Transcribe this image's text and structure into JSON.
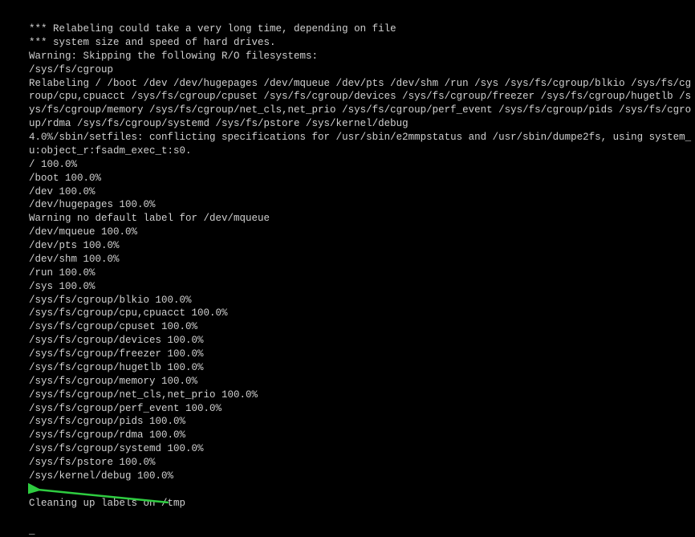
{
  "terminal": {
    "lines": [
      "*** Relabeling could take a very long time, depending on file",
      "*** system size and speed of hard drives.",
      "Warning: Skipping the following R/O filesystems:",
      "/sys/fs/cgroup",
      "Relabeling / /boot /dev /dev/hugepages /dev/mqueue /dev/pts /dev/shm /run /sys /sys/fs/cgroup/blkio /sys/fs/cgroup/cpu,cpuacct /sys/fs/cgroup/cpuset /sys/fs/cgroup/devices /sys/fs/cgroup/freezer /sys/fs/cgroup/hugetlb /sys/fs/cgroup/memory /sys/fs/cgroup/net_cls,net_prio /sys/fs/cgroup/perf_event /sys/fs/cgroup/pids /sys/fs/cgroup/rdma /sys/fs/cgroup/systemd /sys/fs/pstore /sys/kernel/debug",
      "4.0%/sbin/setfiles: conflicting specifications for /usr/sbin/e2mmpstatus and /usr/sbin/dumpe2fs, using system_u:object_r:fsadm_exec_t:s0.",
      "/ 100.0%",
      "/boot 100.0%",
      "/dev 100.0%",
      "/dev/hugepages 100.0%",
      "Warning no default label for /dev/mqueue",
      "/dev/mqueue 100.0%",
      "/dev/pts 100.0%",
      "/dev/shm 100.0%",
      "/run 100.0%",
      "/sys 100.0%",
      "/sys/fs/cgroup/blkio 100.0%",
      "/sys/fs/cgroup/cpu,cpuacct 100.0%",
      "/sys/fs/cgroup/cpuset 100.0%",
      "/sys/fs/cgroup/devices 100.0%",
      "/sys/fs/cgroup/freezer 100.0%",
      "/sys/fs/cgroup/hugetlb 100.0%",
      "/sys/fs/cgroup/memory 100.0%",
      "/sys/fs/cgroup/net_cls,net_prio 100.0%",
      "/sys/fs/cgroup/perf_event 100.0%",
      "/sys/fs/cgroup/pids 100.0%",
      "/sys/fs/cgroup/rdma 100.0%",
      "/sys/fs/cgroup/systemd 100.0%",
      "/sys/fs/pstore 100.0%",
      "/sys/kernel/debug 100.0%",
      "",
      "Cleaning up labels on /tmp"
    ],
    "cursor": "_"
  }
}
